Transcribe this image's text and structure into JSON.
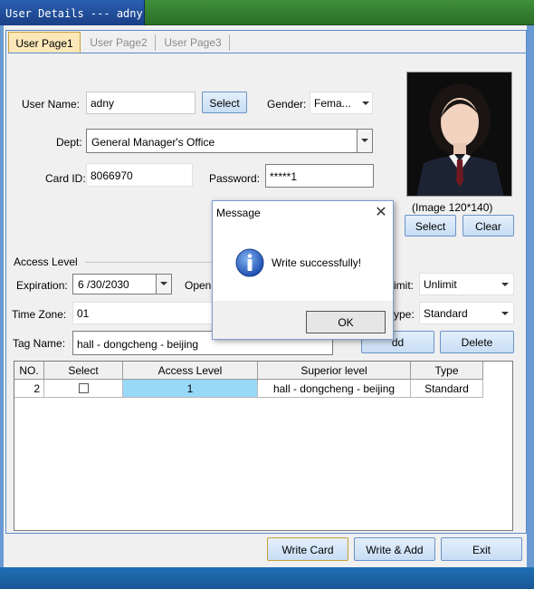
{
  "window": {
    "title": "User Details --- adny"
  },
  "tabs": [
    {
      "label": "User Page1"
    },
    {
      "label": "User Page2"
    },
    {
      "label": "User Page3"
    }
  ],
  "form": {
    "user_name_label": "User Name:",
    "user_name_value": "adny",
    "select_user_button": "Select",
    "gender_label": "Gender:",
    "gender_value": "Fema...",
    "dept_label": "Dept:",
    "dept_value": "General Manager's Office",
    "card_id_label": "Card ID:",
    "card_id_value": "8066970",
    "password_label": "Password:",
    "password_value": "*****1",
    "image_caption": "(Image 120*140)",
    "photo_select_button": "Select",
    "photo_clear_button": "Clear"
  },
  "access": {
    "section_label": "Access Level",
    "expiration_label": "Expiration:",
    "expiration_value": "6 /30/2030",
    "open_label": "Open",
    "limit_label": "imit:",
    "limit_value": "Unlimit",
    "time_zone_label": "Time Zone:",
    "time_zone_value": "01",
    "type_label": "ype:",
    "type_value": "Standard",
    "tag_name_label": "Tag Name:",
    "tag_name_value": "hall - dongcheng - beijing",
    "add_button": "dd",
    "delete_button": "Delete"
  },
  "table": {
    "columns": [
      "NO.",
      "Select",
      "Access Level",
      "Superior level",
      "Type"
    ],
    "rows": [
      {
        "no": "2",
        "select": false,
        "access_level": "1",
        "superior_level": "hall - dongcheng - beijing",
        "type": "Standard"
      }
    ]
  },
  "footer": {
    "write_card_button": "Write Card",
    "write_add_button": "Write & Add",
    "exit_button": "Exit"
  },
  "dialog": {
    "title": "Message",
    "message": "Write successfully!",
    "ok_button": "OK",
    "icon": "info-icon"
  },
  "colors": {
    "accent_blue": "#1f5fa8",
    "selected_cell": "#99d9f8",
    "active_tab": "#fbe7b8"
  }
}
